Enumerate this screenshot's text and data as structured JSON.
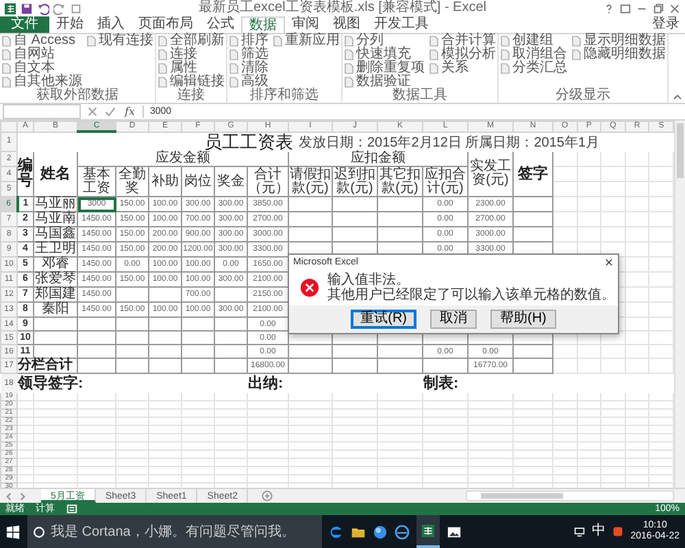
{
  "window": {
    "title": "最新员工excel工资表模板.xls [兼容模式] - Excel"
  },
  "ribbon_tabs": [
    {
      "label": "文件",
      "kind": "file",
      "selected": false
    },
    {
      "label": "开始",
      "kind": "tab",
      "selected": false
    },
    {
      "label": "插入",
      "kind": "tab",
      "selected": false
    },
    {
      "label": "页面布局",
      "kind": "tab",
      "selected": false
    },
    {
      "label": "公式",
      "kind": "tab",
      "selected": false
    },
    {
      "label": "数据",
      "kind": "tab",
      "selected": true
    },
    {
      "label": "审阅",
      "kind": "tab",
      "selected": false
    },
    {
      "label": "视图",
      "kind": "tab",
      "selected": false
    },
    {
      "label": "开发工具",
      "kind": "tab",
      "selected": false
    }
  ],
  "account": "登录",
  "ribbon_groups": [
    {
      "label": "获取外部数据",
      "columns": [
        [
          "自 Access",
          "自网站",
          "自文本",
          "自其他来源"
        ],
        [
          "现有连接"
        ]
      ]
    },
    {
      "label": "连接",
      "columns": [
        [
          "全部刷新",
          "连接",
          "属性",
          "编辑链接"
        ]
      ]
    },
    {
      "label": "排序和筛选",
      "columns": [
        [
          "排序",
          "筛选",
          "清除",
          "高级"
        ],
        [
          "重新应用"
        ]
      ]
    },
    {
      "label": "数据工具",
      "columns": [
        [
          "分列",
          "快速填充",
          "删除重复项",
          "数据验证"
        ],
        [
          "合并计算",
          "模拟分析",
          "关系"
        ]
      ]
    },
    {
      "label": "分级显示",
      "columns": [
        [
          "创建组",
          "取消组合",
          "分类汇总"
        ],
        [
          "显示明细数据",
          "隐藏明细数据"
        ]
      ]
    }
  ],
  "formula_bar": {
    "function_label": "fx",
    "value": "3000"
  },
  "columns": [
    {
      "label": "A",
      "selected": false
    },
    {
      "label": "B",
      "selected": false
    },
    {
      "label": "C",
      "selected": true
    },
    {
      "label": "D",
      "selected": false
    },
    {
      "label": "E",
      "selected": false
    },
    {
      "label": "F",
      "selected": false
    },
    {
      "label": "G",
      "selected": false
    },
    {
      "label": "H",
      "selected": false
    },
    {
      "label": "I",
      "selected": false
    },
    {
      "label": "J",
      "selected": false
    },
    {
      "label": "K",
      "selected": false
    },
    {
      "label": "L",
      "selected": false
    },
    {
      "label": "M",
      "selected": false
    },
    {
      "label": "N",
      "selected": false
    },
    {
      "label": "O",
      "selected": false
    },
    {
      "label": "P",
      "selected": false
    },
    {
      "label": "Q",
      "selected": false
    },
    {
      "label": "R",
      "selected": false
    },
    {
      "label": "S",
      "selected": false
    }
  ],
  "sheet": {
    "title_row": {
      "number": "1",
      "title": "员工工资表",
      "date_info": "发放日期：2015年2月12日 所属日期：2015年1月"
    },
    "header_row_numbers": [
      "2",
      "4",
      "5"
    ],
    "header": {
      "number": "编号",
      "name": "姓名",
      "earnings": "应发金额",
      "earning_columns": [
        "基本工资",
        "全勤奖",
        "补助",
        "岗位",
        "奖金",
        "合计（元）"
      ],
      "deductions": "应扣金额",
      "deduction_columns": [
        "请假扣款(元)",
        "迟到扣款(元)",
        "其它扣款(元)",
        "应扣合计(元)"
      ],
      "net_pay": "实发工资(元)",
      "signature": "签字"
    },
    "rows": [
      {
        "number": "6",
        "no": "1",
        "name": "马亚丽",
        "earnings": {
          "basic": "3000",
          "attendance": "150.00",
          "allowance": "100.00",
          "post": "300.00",
          "bonus": "300.00",
          "total": "3850.00"
        },
        "deduction_total": "0.00",
        "net_pay": "2300.00",
        "selected": true
      },
      {
        "number": "7",
        "no": "2",
        "name": "马亚南",
        "earnings": {
          "basic": "1450.00",
          "attendance": "150.00",
          "allowance": "100.00",
          "post": "700.00",
          "bonus": "300.00",
          "total": "2700.00"
        },
        "deduction_total": "0.00",
        "net_pay": "2700.00",
        "selected": false
      },
      {
        "number": "8",
        "no": "3",
        "name": "马国鑫",
        "earnings": {
          "basic": "1450.00",
          "attendance": "150.00",
          "allowance": "200.00",
          "post": "900.00",
          "bonus": "300.00",
          "total": "3000.00"
        },
        "deduction_total": "0.00",
        "net_pay": "3000.00",
        "selected": false
      },
      {
        "number": "9",
        "no": "4",
        "name": "王卫明",
        "earnings": {
          "basic": "1450.00",
          "attendance": "150.00",
          "allowance": "200.00",
          "post": "1200.00",
          "bonus": "300.00",
          "total": "3300.00"
        },
        "deduction_total": "0.00",
        "net_pay": "3300.00",
        "selected": false
      },
      {
        "number": "10",
        "no": "5",
        "name": "邓睿",
        "earnings": {
          "basic": "1450.00",
          "attendance": "0.00",
          "allowance": "100.00",
          "post": "100.00",
          "bonus": "0.00",
          "total": "1650.00"
        },
        "selected": false
      },
      {
        "number": "11",
        "no": "6",
        "name": "张爱琴",
        "earnings": {
          "basic": "1450.00",
          "attendance": "150.00",
          "allowance": "100.00",
          "post": "100.00",
          "bonus": "300.00",
          "total": "2100.00"
        },
        "selected": false
      },
      {
        "number": "12",
        "no": "7",
        "name": "郑国建",
        "earnings": {
          "basic": "1450.00",
          "post": "700.00",
          "total": "2150.00"
        },
        "selected": false
      },
      {
        "number": "13",
        "no": "8",
        "name": "秦阳",
        "earnings": {
          "basic": "1450.00",
          "attendance": "150.00",
          "allowance": "100.00",
          "post": "100.00",
          "bonus": "300.00",
          "total": "2100.00"
        },
        "selected": false
      },
      {
        "number": "14",
        "no": "9",
        "earnings": {
          "total": "0.00"
        },
        "selected": false
      },
      {
        "number": "15",
        "no": "10",
        "earnings": {
          "total": "0.00"
        },
        "selected": false
      },
      {
        "number": "16",
        "no": "11",
        "earnings": {
          "total": "0.00"
        },
        "deduction_total": "0.00",
        "net_pay": "0.00",
        "selected": false
      }
    ],
    "total_row": {
      "number": "17",
      "label": "分栏合计",
      "earnings_total": "16800.00",
      "net_pay": "16770.00"
    },
    "signature_row": {
      "number": "18",
      "items": [
        "领导签字:",
        "出纳:",
        "制表:"
      ]
    },
    "empty_row_numbers": [
      "19",
      "20",
      "21",
      "22",
      "23",
      "24",
      "25",
      "26",
      "27",
      "28",
      "29",
      "30"
    ]
  },
  "dialog": {
    "title": "Microsoft Excel",
    "message": "输入值非法。",
    "detail": "其他用户已经限定了可以输入该单元格的数值。",
    "buttons": [
      {
        "label": "重试(R)",
        "selected": true
      },
      {
        "label": "取消",
        "selected": false
      },
      {
        "label": "帮助(H)",
        "selected": false
      }
    ]
  },
  "sheet_tabs": [
    {
      "label": "5月工资",
      "selected": true
    },
    {
      "label": "Sheet3",
      "selected": false
    },
    {
      "label": "Sheet1",
      "selected": false
    },
    {
      "label": "Sheet2",
      "selected": false
    }
  ],
  "status_bar": {
    "items": [
      "就绪",
      "计算"
    ],
    "zoom": "100%"
  },
  "taskbar": {
    "search_placeholder": "我是 Cortana，小娜。有问题尽管问我。",
    "ime": "中",
    "time": "10:10",
    "date": "2016-04-22"
  }
}
